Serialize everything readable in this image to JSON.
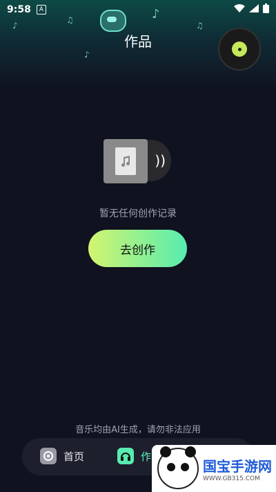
{
  "status_bar": {
    "time": "9:58",
    "notification": "A"
  },
  "header": {
    "title": "作品"
  },
  "empty_state": {
    "message": "暂无任何创作记录",
    "button_label": "去创作"
  },
  "footer": {
    "disclaimer": "音乐均由AI生成，请勿非法应用"
  },
  "bottom_nav": {
    "items": [
      {
        "label": "首页",
        "icon": "music-disc-icon"
      },
      {
        "label": "作",
        "icon": "headphones-icon",
        "active": true
      }
    ]
  },
  "watermark": {
    "title": "国宝手游网",
    "url": "WWW.GB315.COM"
  },
  "colors": {
    "accent": "#57ecb0",
    "accent_start": "#d2f56f",
    "background": "#10121f"
  }
}
